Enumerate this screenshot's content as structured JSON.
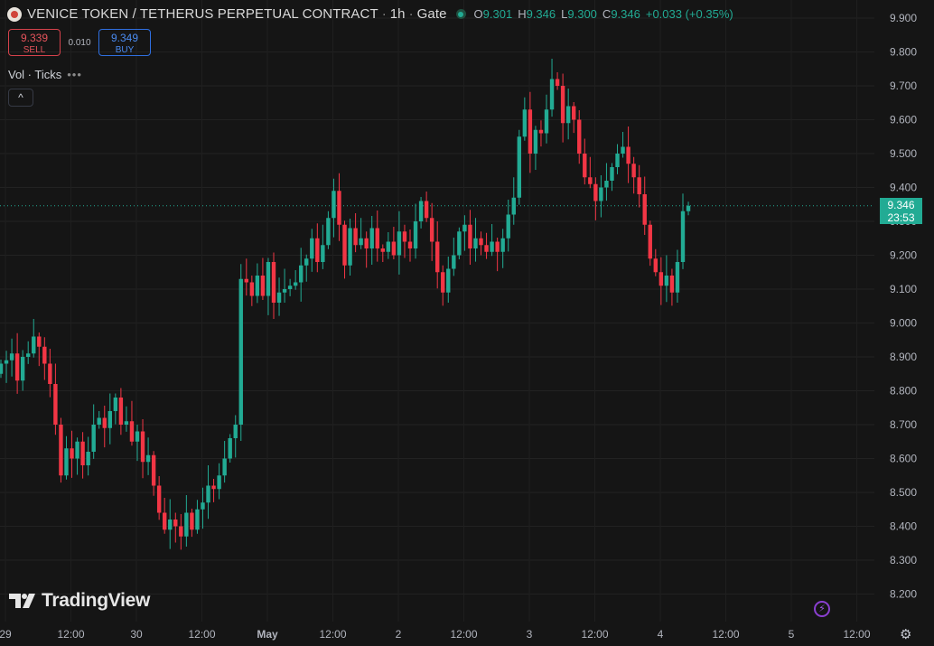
{
  "header": {
    "title": "VENICE TOKEN / TETHERUS PERPETUAL CONTRACT",
    "separator": "·",
    "interval": "1h",
    "exchange": "Gate",
    "open_label": "O",
    "open": "9.301",
    "high_label": "H",
    "high": "9.346",
    "low_label": "L",
    "low": "9.300",
    "close_label": "C",
    "close": "9.346",
    "change": "+0.033 (+0.35%)"
  },
  "trade": {
    "sell_price": "9.339",
    "sell_label": "SELL",
    "spread": "0.010",
    "buy_price": "9.349",
    "buy_label": "BUY"
  },
  "indicator": {
    "label": "Vol · Ticks",
    "more": "•••"
  },
  "collapse_icon": "^",
  "watermark": "TradingView",
  "last_price": {
    "value": "9.346",
    "countdown": "23:53"
  },
  "colors": {
    "up": "#22ab94",
    "down": "#f23645",
    "background": "#151515",
    "last_price": "#22ab94"
  },
  "icons": [
    "venice-token-logo-icon",
    "live-status-icon",
    "chevron-up-icon",
    "tradingview-logo-icon",
    "lightning-icon",
    "settings-gear-icon"
  ],
  "chart_data": {
    "type": "candlestick",
    "y_ticks": [
      "9.900",
      "9.800",
      "9.700",
      "9.600",
      "9.500",
      "9.400",
      "9.300",
      "9.200",
      "9.100",
      "9.000",
      "8.900",
      "8.800",
      "8.700",
      "8.600",
      "8.500",
      "8.400",
      "8.300",
      "8.200"
    ],
    "x_ticks": [
      "29",
      "12:00",
      "30",
      "12:00",
      "May",
      "12:00",
      "2",
      "12:00",
      "3",
      "12:00",
      "4",
      "12:00",
      "5",
      "12:00"
    ],
    "ylim": [
      8.15,
      9.95
    ],
    "grid": true,
    "last_price": 9.346,
    "closes": [
      8.88,
      8.89,
      8.91,
      8.83,
      8.9,
      8.91,
      8.96,
      8.93,
      8.88,
      8.82,
      8.7,
      8.55,
      8.63,
      8.6,
      8.65,
      8.58,
      8.62,
      8.7,
      8.72,
      8.69,
      8.74,
      8.78,
      8.7,
      8.71,
      8.65,
      8.68,
      8.59,
      8.61,
      8.52,
      8.44,
      8.39,
      8.42,
      8.4,
      8.37,
      8.44,
      8.39,
      8.45,
      8.47,
      8.52,
      8.51,
      8.55,
      8.6,
      8.66,
      8.7,
      9.13,
      9.12,
      9.08,
      9.14,
      9.08,
      9.18,
      9.06,
      9.09,
      9.1,
      9.11,
      9.12,
      9.17,
      9.19,
      9.25,
      9.18,
      9.23,
      9.31,
      9.39,
      9.29,
      9.17,
      9.28,
      9.23,
      9.25,
      9.22,
      9.28,
      9.22,
      9.21,
      9.24,
      9.2,
      9.27,
      9.24,
      9.22,
      9.3,
      9.36,
      9.31,
      9.24,
      9.15,
      9.09,
      9.16,
      9.2,
      9.27,
      9.29,
      9.22,
      9.25,
      9.23,
      9.21,
      9.24,
      9.21,
      9.25,
      9.32,
      9.37,
      9.55,
      9.63,
      9.5,
      9.57,
      9.56,
      9.63,
      9.72,
      9.7,
      9.59,
      9.64,
      9.6,
      9.5,
      9.43,
      9.41,
      9.36,
      9.4,
      9.42,
      9.46,
      9.5,
      9.52,
      9.47,
      9.43,
      9.38,
      9.29,
      9.19,
      9.15,
      9.11,
      9.14,
      9.09,
      9.18,
      9.33,
      9.346
    ]
  }
}
